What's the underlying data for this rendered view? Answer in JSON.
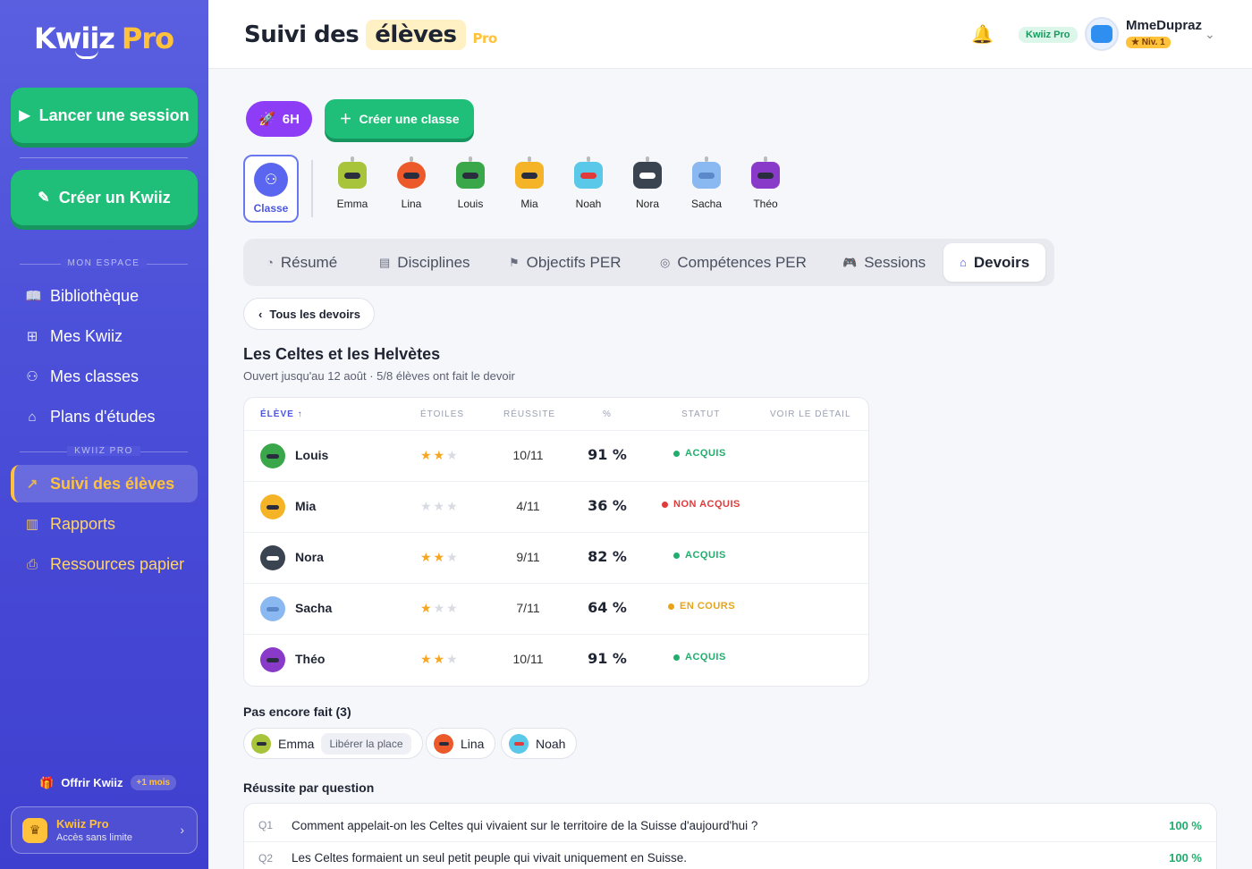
{
  "sidebar": {
    "logo_main": "Kwiiz",
    "logo_pro": "Pro",
    "launch_label": "Lancer une session",
    "create_label": "Créer un Kwiiz",
    "section_mon_espace": "MON ESPACE",
    "section_kwiiz_pro": "KWIIZ PRO",
    "nav": [
      {
        "label": "Bibliothèque",
        "icon": "book-icon"
      },
      {
        "label": "Mes Kwiiz",
        "icon": "grid-icon"
      },
      {
        "label": "Mes classes",
        "icon": "users-icon"
      },
      {
        "label": "Plans d'études",
        "icon": "graduation-cap-icon"
      },
      {
        "label": "Suivi des élèves",
        "icon": "trend-icon"
      },
      {
        "label": "Rapports",
        "icon": "bar-chart-icon"
      },
      {
        "label": "Ressources papier",
        "icon": "printer-icon"
      }
    ],
    "offrir_label": "Offrir Kwiiz",
    "offrir_badge": "+1 mois",
    "pro_card_title": "Kwiiz Pro",
    "pro_card_sub": "Accès sans limite"
  },
  "header": {
    "title_a": "Suivi des",
    "title_hl": "élèves",
    "title_pro": "Pro",
    "badge": "Kwiiz Pro",
    "username": "MmeDupraz",
    "level": "★ Niv. 1"
  },
  "toolbar": {
    "class_chip": "6H",
    "create_class": "Créer une classe"
  },
  "students": {
    "classe_label": "Classe",
    "list": [
      {
        "name": "Emma",
        "color": "#a8c43a"
      },
      {
        "name": "Lina",
        "color": "#ec5a2c"
      },
      {
        "name": "Louis",
        "color": "#3aa84a"
      },
      {
        "name": "Mia",
        "color": "#f5b428"
      },
      {
        "name": "Noah",
        "color": "#5ac8e8"
      },
      {
        "name": "Nora",
        "color": "#3a4450"
      },
      {
        "name": "Sacha",
        "color": "#8ab8f0"
      },
      {
        "name": "Théo",
        "color": "#8a3ac8"
      }
    ]
  },
  "tabs": [
    {
      "label": "Résumé",
      "icon": "gauge-icon"
    },
    {
      "label": "Disciplines",
      "icon": "books-icon"
    },
    {
      "label": "Objectifs PER",
      "icon": "flag-icon"
    },
    {
      "label": "Compétences PER",
      "icon": "target-icon"
    },
    {
      "label": "Sessions",
      "icon": "gamepad-icon"
    },
    {
      "label": "Devoirs",
      "icon": "house-icon"
    }
  ],
  "homework": {
    "back_label": "Tous les devoirs",
    "title": "Les Celtes et les Helvètes",
    "subtitle": "Ouvert jusqu'au 12 août · 5/8 élèves ont fait le devoir",
    "columns": {
      "eleve": "ÉLÈVE",
      "etoiles": "ÉTOILES",
      "reussite": "RÉUSSITE",
      "pct": "%",
      "statut": "STATUT",
      "detail": "VOIR LE DÉTAIL"
    },
    "rows": [
      {
        "name": "Louis",
        "stars": 2,
        "score": "10/11",
        "pct": "91 %",
        "status": "ACQUIS",
        "status_color": "#1fae6e",
        "avatar_color": "#3aa84a"
      },
      {
        "name": "Mia",
        "stars": 0,
        "score": "4/11",
        "pct": "36 %",
        "status": "NON ACQUIS",
        "status_color": "#e03a3a",
        "avatar_color": "#f5b428"
      },
      {
        "name": "Nora",
        "stars": 2,
        "score": "9/11",
        "pct": "82 %",
        "status": "ACQUIS",
        "status_color": "#1fae6e",
        "avatar_color": "#3a4450"
      },
      {
        "name": "Sacha",
        "stars": 1,
        "score": "7/11",
        "pct": "64 %",
        "status": "EN COURS",
        "status_color": "#e8a317",
        "avatar_color": "#8ab8f0"
      },
      {
        "name": "Théo",
        "stars": 2,
        "score": "10/11",
        "pct": "91 %",
        "status": "ACQUIS",
        "status_color": "#1fae6e",
        "avatar_color": "#8a3ac8"
      }
    ]
  },
  "pending": {
    "title": "Pas encore fait (3)",
    "liberer": "Libérer la place",
    "list": [
      {
        "name": "Emma",
        "color": "#a8c43a"
      },
      {
        "name": "Lina",
        "color": "#ec5a2c"
      },
      {
        "name": "Noah",
        "color": "#5ac8e8"
      }
    ]
  },
  "questions": {
    "title": "Réussite par question",
    "list": [
      {
        "id": "Q1",
        "text": "Comment appelait-on les Celtes qui vivaient sur le territoire de la Suisse d'aujourd'hui ?",
        "pct": "100 %"
      },
      {
        "id": "Q2",
        "text": "Les Celtes formaient un seul petit peuple qui vivait uniquement en Suisse.",
        "pct": "100 %"
      }
    ]
  }
}
